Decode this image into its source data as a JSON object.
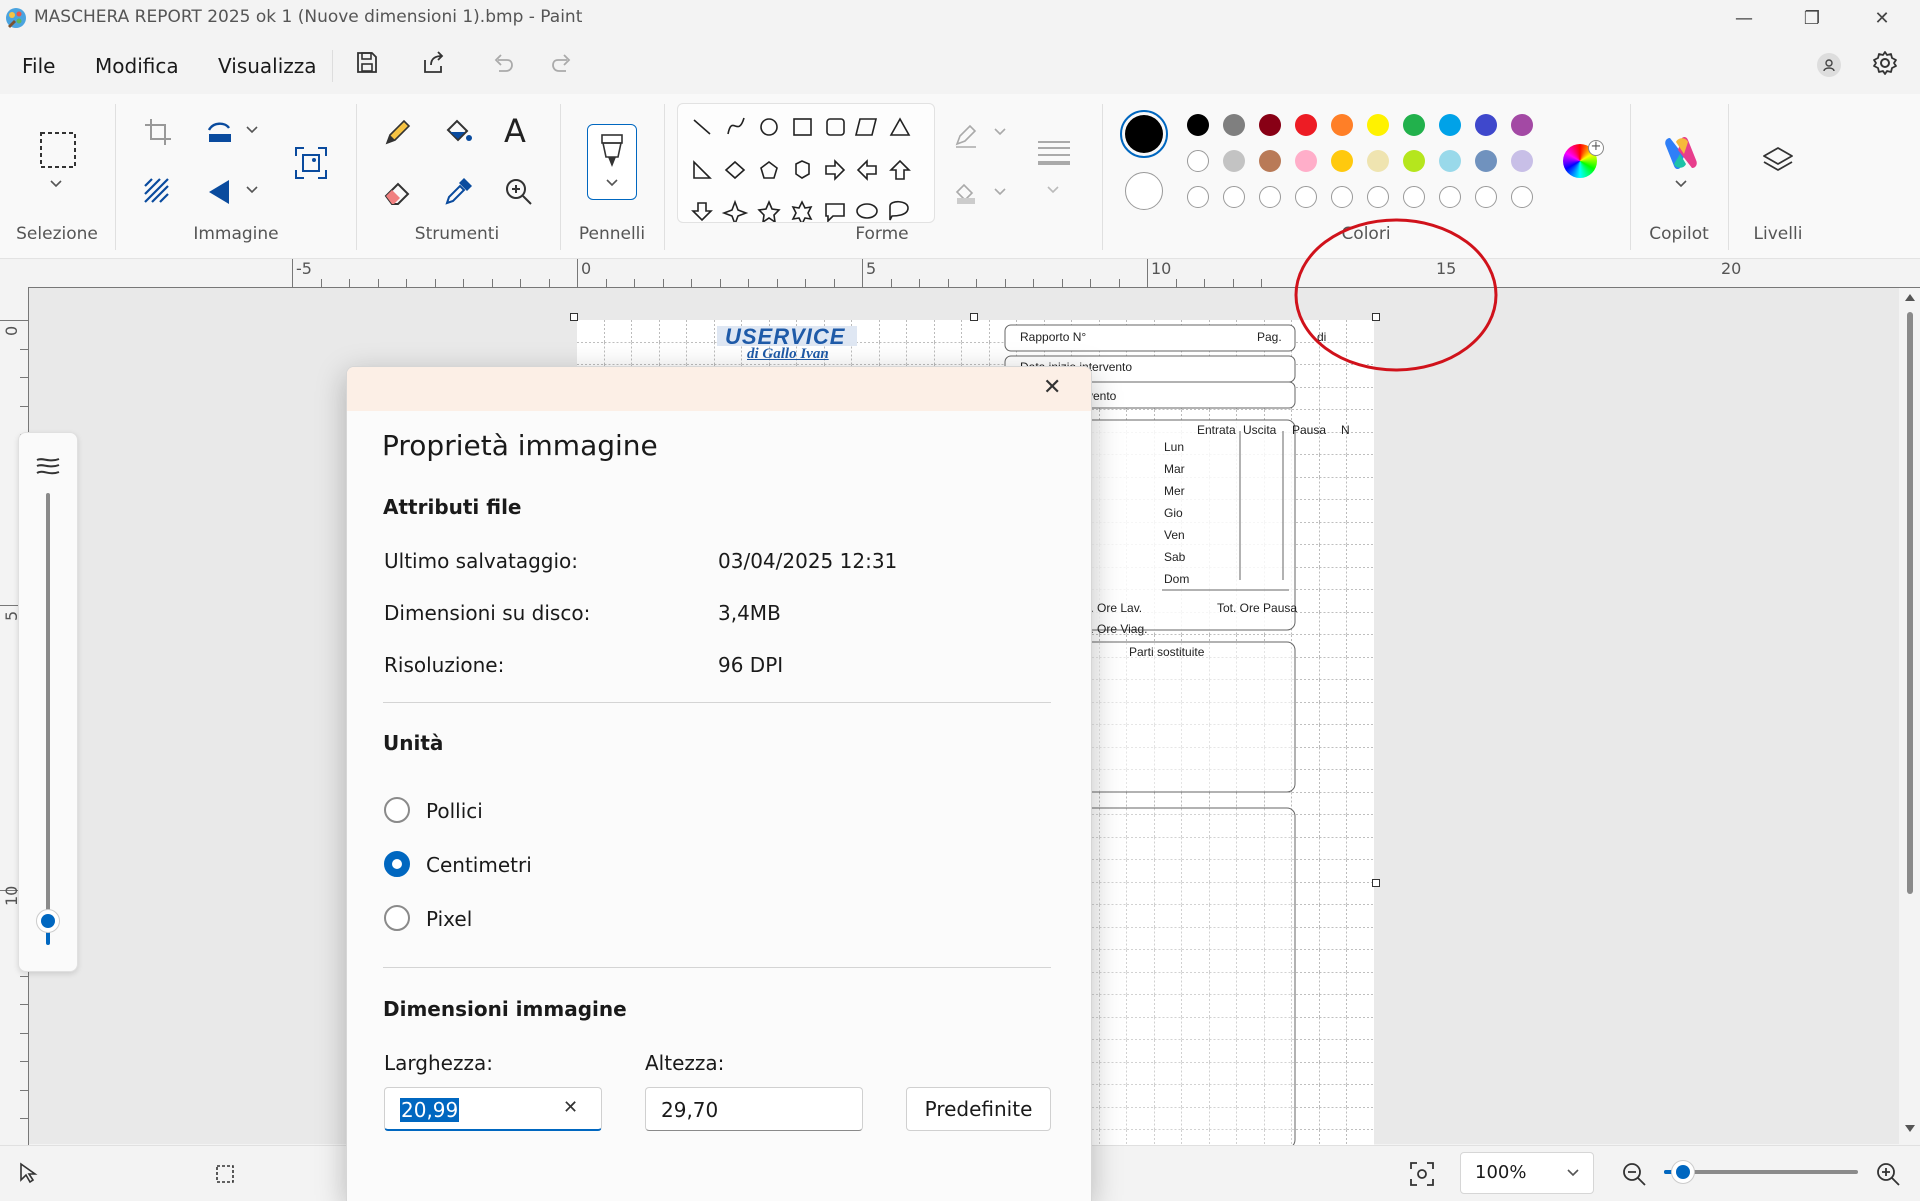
{
  "window": {
    "title": "MASCHERA REPORT 2025 ok 1 (Nuove dimensioni 1).bmp - Paint",
    "min_glyph": "—",
    "max_glyph": "❐",
    "close_glyph": "✕"
  },
  "menu": {
    "file": "File",
    "edit": "Modifica",
    "view": "Visualizza"
  },
  "ribbon": {
    "groups": {
      "selection": "Selezione",
      "image": "Immagine",
      "tools": "Strumenti",
      "brushes": "Pennelli",
      "shapes": "Forme",
      "colors": "Colori",
      "copilot": "Copilot",
      "layers": "Livelli"
    },
    "text_tool_glyph": "A",
    "colors": {
      "primary": "#000000",
      "secondary": "#ffffff",
      "row1": [
        "#000000",
        "#7f7f7f",
        "#880015",
        "#ed1c24",
        "#ff7f27",
        "#fff200",
        "#22b14c",
        "#00a2e8",
        "#3f48cc",
        "#a349a4"
      ],
      "row2": [
        "#ffffff",
        "#c3c3c3",
        "#b97a57",
        "#ffaec9",
        "#ffc90e",
        "#efe4b0",
        "#b5e61d",
        "#99d9ea",
        "#7092be",
        "#c8bfe7"
      ],
      "accent": "#0067c0",
      "annotation_circle": "#d0121b"
    }
  },
  "ruler": {
    "h_labels": [
      "-5",
      "0",
      "5",
      "10",
      "15",
      "20"
    ],
    "v_labels": [
      "0",
      "5",
      "10"
    ]
  },
  "document": {
    "logo_line1": "USERVICE",
    "logo_line2": "di Gallo Ivan",
    "rapporto": "Rapporto N°",
    "pag": "Pag.",
    "di": "di",
    "data_inizio": "Data inizio intervento",
    "vento": "vento",
    "col_entrata": "Entrata",
    "col_uscita": "Uscita",
    "col_pausa": "Pausa",
    "col_n": "N",
    "days": [
      "Lun",
      "Mar",
      "Mer",
      "Gio",
      "Ven",
      "Sab",
      "Dom"
    ],
    "tot_ore_lav": "t. Ore Lav.",
    "tot_ore_pausa": "Tot. Ore Pausa",
    "tot_ore_viag": "t. Ore Viag.",
    "parti_sostituite": "Parti sostituite"
  },
  "dialog": {
    "title": "Proprietà immagine",
    "close_glyph": "✕",
    "file_section": "Attributi file",
    "last_saved_label": "Ultimo salvataggio:",
    "last_saved_value": "03/04/2025 12:31",
    "disk_size_label": "Dimensioni su disco:",
    "disk_size_value": "3,4MB",
    "resolution_label": "Risoluzione:",
    "resolution_value": "96 DPI",
    "units_section": "Unità",
    "unit_inches": "Pollici",
    "unit_cm": "Centimetri",
    "unit_px": "Pixel",
    "selected_unit": "Centimetri",
    "dimensions_section": "Dimensioni immagine",
    "width_label": "Larghezza:",
    "width_value": "20,99",
    "height_label": "Altezza:",
    "height_value": "29,70",
    "defaults_button": "Predefinite",
    "clear_glyph": "✕"
  },
  "status": {
    "zoom": "100%",
    "zoom_level": 0.1
  }
}
